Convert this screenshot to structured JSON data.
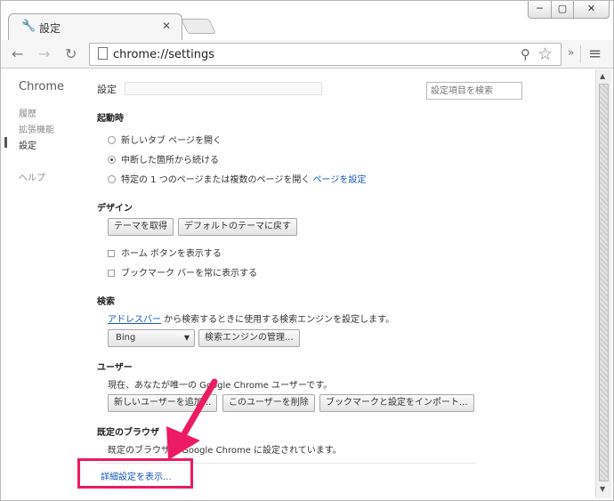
{
  "window": {
    "controls": {
      "minimize": "─",
      "maximize": "▢",
      "close": "✕"
    }
  },
  "tab": {
    "icon": "wrench-icon",
    "title": "設定",
    "close": "✕"
  },
  "toolbar": {
    "back": "←",
    "forward": "→",
    "reload": "↻",
    "url": "chrome://settings",
    "extensions": "»",
    "menu": "≡"
  },
  "sidebar": {
    "brand": "Chrome",
    "items": [
      {
        "label": "履歴"
      },
      {
        "label": "拡張機能"
      },
      {
        "label": "設定"
      },
      {
        "label": "ヘルプ"
      }
    ]
  },
  "main": {
    "title": "設定",
    "search_placeholder": "設定項目を検索",
    "startup": {
      "heading": "起動時",
      "options": [
        {
          "label": "新しいタブ ページを開く",
          "selected": false
        },
        {
          "label": "中断した箇所から続ける",
          "selected": true
        },
        {
          "label": "特定の 1 つのページまたは複数のページを開く",
          "selected": false
        }
      ],
      "set_pages_link": "ページを設定"
    },
    "appearance": {
      "heading": "デザイン",
      "get_themes": "テーマを取得",
      "reset_theme": "デフォルトのテーマに戻す",
      "show_home": "ホーム ボタンを表示する",
      "show_bookmarks_bar": "ブックマーク バーを常に表示する"
    },
    "search": {
      "heading": "検索",
      "description_link": "アドレスバー",
      "description_rest": " から検索するときに使用する検索エンジンを設定します。",
      "engine": "Bing",
      "manage": "検索エンジンの管理..."
    },
    "users": {
      "heading": "ユーザー",
      "description": "現在、あなたが唯一の Google Chrome ユーザーです。",
      "add_user": "新しいユーザーを追加...",
      "delete_user": "このユーザーを削除",
      "import": "ブックマークと設定をインポート..."
    },
    "default_browser": {
      "heading": "既定のブラウザ",
      "description": "既定のブラウザは Google Chrome に設定されています。"
    },
    "advanced_link": "詳細設定を表示..."
  },
  "colors": {
    "annotation": "#ec1b63",
    "link": "#1558b9"
  }
}
